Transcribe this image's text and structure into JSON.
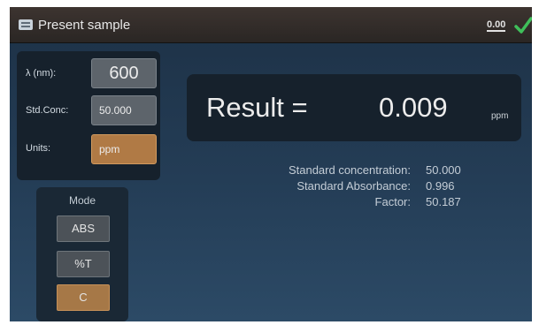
{
  "title": "Present sample",
  "status": {
    "value": "0.00",
    "check_color": "#3fbf5a"
  },
  "fields": {
    "wavelength": {
      "label": "λ (nm):",
      "value": "600"
    },
    "std_conc": {
      "label": "Std.Conc:",
      "value": "50.000"
    },
    "units": {
      "label": "Units:",
      "value": "ppm"
    }
  },
  "mode": {
    "label": "Mode",
    "options": [
      "ABS",
      "%T",
      "C"
    ],
    "selected": "C"
  },
  "result": {
    "label": "Result =",
    "value": "0.009",
    "unit": "ppm"
  },
  "info": {
    "labels": [
      "Standard concentration:",
      "Standard Absorbance:",
      "Factor:"
    ],
    "values": [
      "50.000",
      "0.996",
      "50.187"
    ]
  },
  "colors": {
    "accent": "#b07a45",
    "panel": "#16212c"
  }
}
